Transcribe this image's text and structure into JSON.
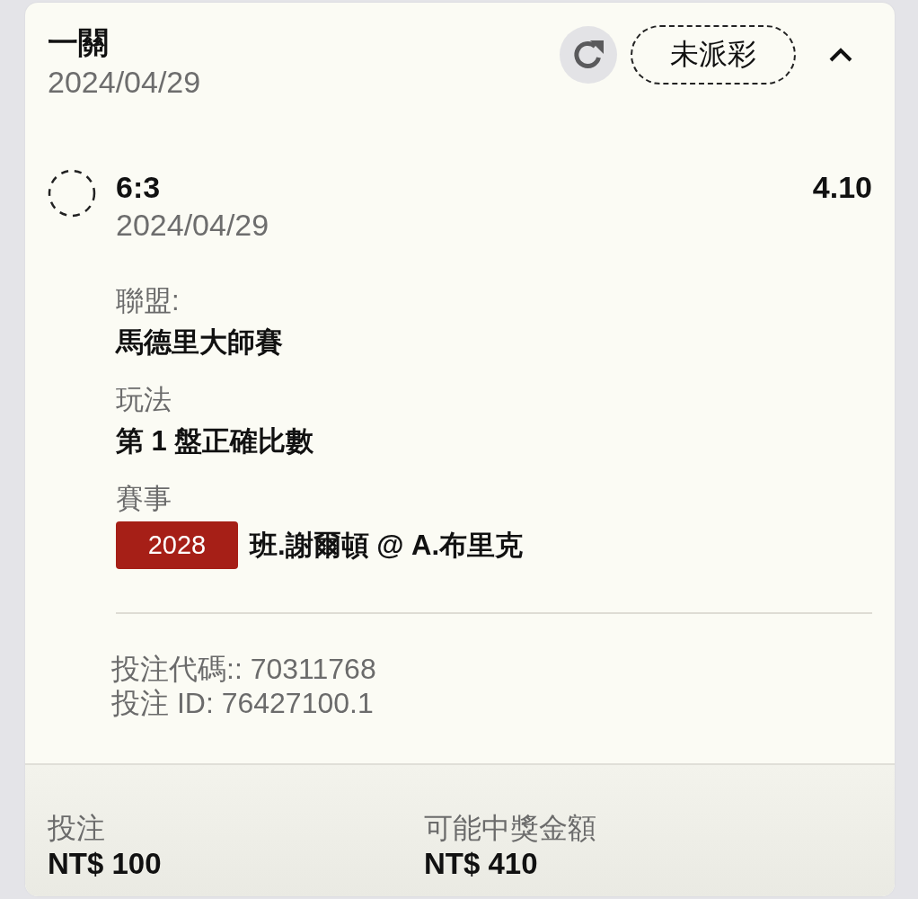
{
  "bet": {
    "title": "一關",
    "date": "2024/04/29",
    "status": "未派彩",
    "expanded": true
  },
  "selections": [
    {
      "settled": false,
      "pick": "6:3",
      "date": "2024/04/29",
      "odds": "4.10",
      "details": [
        {
          "kind": "text",
          "label": "聯盟:",
          "value": "馬德里大師賽"
        },
        {
          "kind": "text",
          "label": "玩法",
          "value": "第 1 盤正確比數"
        },
        {
          "kind": "event",
          "label": "賽事",
          "code": "2028",
          "value": "班.謝爾頓 @ A.布里克"
        }
      ]
    }
  ],
  "references": [
    "投注代碼:: 70311768",
    "投注 ID: 76427100.1"
  ],
  "summary": [
    {
      "label": "投注",
      "value": "NT$ 100"
    },
    {
      "label": "可能中獎金額",
      "value": "NT$ 410"
    }
  ]
}
